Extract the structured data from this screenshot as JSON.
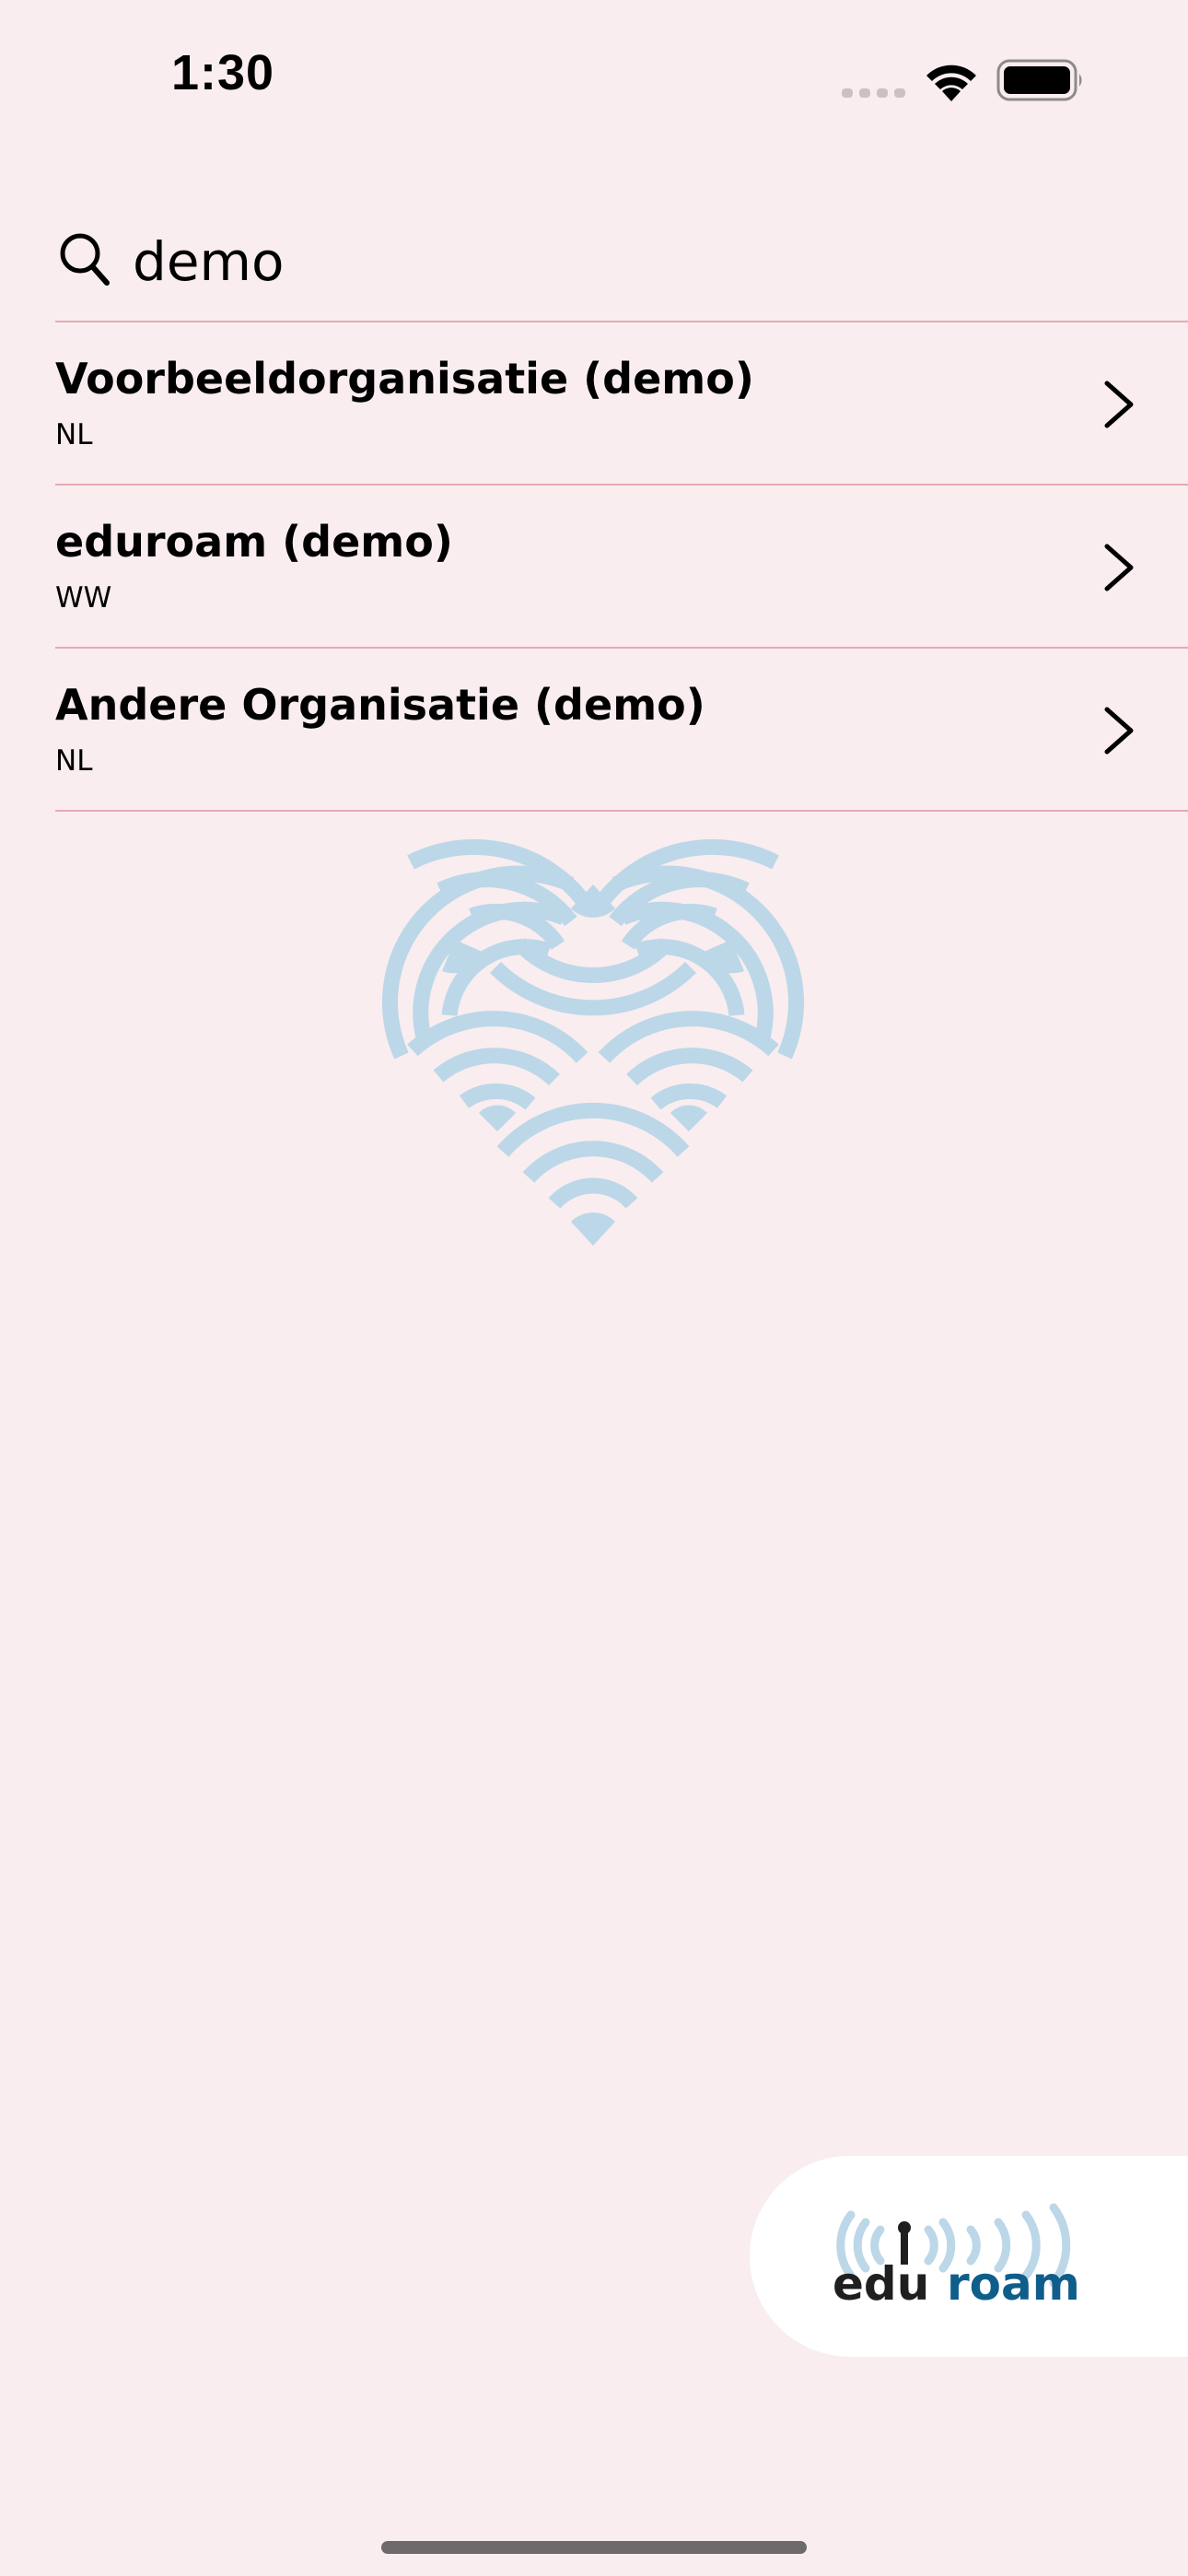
{
  "status_bar": {
    "time": "1:30",
    "icons": [
      "cellular-signal-icon",
      "wifi-icon",
      "battery-icon"
    ]
  },
  "search": {
    "value": "demo",
    "placeholder": ""
  },
  "results": [
    {
      "name": "Voorbeeldorganisatie (demo)",
      "country": "NL"
    },
    {
      "name": "eduroam (demo)",
      "country": "WW"
    },
    {
      "name": "Andere Organisatie (demo)",
      "country": "NL"
    }
  ],
  "logo": {
    "text_dark": "edu",
    "text_blue": "roam"
  },
  "colors": {
    "background": "#F9EDEF",
    "divider": "#E8A9B2",
    "heart_blue": "#BCD7E8",
    "logo_blue": "#0F5D8A",
    "logo_dark": "#1F1F1F"
  }
}
